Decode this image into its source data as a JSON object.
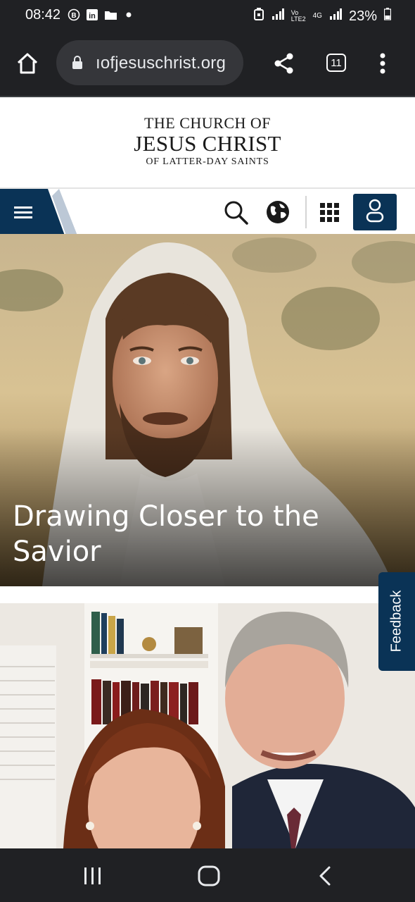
{
  "status_bar": {
    "time": "08:42",
    "battery": "23%",
    "icons": [
      "b-circle-icon",
      "linkedin-icon",
      "folder-icon",
      "dot-icon",
      "alarm-icon",
      "signal-icon",
      "volte-icon",
      "4g-icon",
      "battery-icon"
    ],
    "network_top": "Vo",
    "network_bottom": "LTE2",
    "network_type": "4G"
  },
  "browser": {
    "url": "ıofjesuschrist.org",
    "tab_count": "11",
    "icons": [
      "home-icon",
      "lock-icon",
      "share-icon",
      "tab-switcher-icon",
      "more-vert-icon"
    ]
  },
  "logo": {
    "line1": "THE CHURCH OF",
    "line2": "JESUS CHRIST",
    "line3": "OF LATTER-DAY SAINTS"
  },
  "nav": {
    "icons": [
      "menu-icon",
      "search-icon",
      "globe-icon",
      "apps-grid-icon",
      "user-icon"
    ]
  },
  "hero": {
    "title": "Drawing Closer to the Savior"
  },
  "feedback": {
    "label": "Feedback"
  },
  "colors": {
    "brand_navy": "#0a3356",
    "chrome_dark": "#202124",
    "url_pill": "#35363a"
  },
  "system_nav": {
    "icons": [
      "recents-icon",
      "home-circle-icon",
      "back-icon"
    ]
  }
}
